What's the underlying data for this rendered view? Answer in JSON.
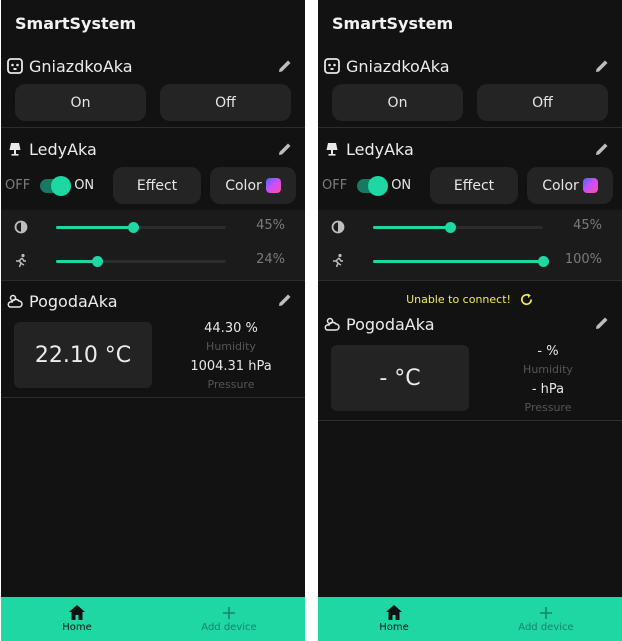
{
  "screens": [
    {
      "app_title": "SmartSystem",
      "socket": {
        "name": "GniazdkoAka",
        "on_label": "On",
        "off_label": "Off"
      },
      "leds": {
        "name": "LedyAka",
        "off_label": "OFF",
        "on_label": "ON",
        "toggle_on": true,
        "effect_label": "Effect",
        "color_label": "Color",
        "brightness": {
          "value": 45,
          "text": "45%"
        },
        "speed": {
          "value": 24,
          "text": "24%"
        }
      },
      "error": null,
      "weather": {
        "name": "PogodaAka",
        "temperature": "22.10 °C",
        "humidity": "44.30 %",
        "humidity_label": "Humidity",
        "pressure": "1004.31 hPa",
        "pressure_label": "Pressure"
      },
      "nav": {
        "home": "Home",
        "add": "Add device"
      }
    },
    {
      "app_title": "SmartSystem",
      "socket": {
        "name": "GniazdkoAka",
        "on_label": "On",
        "off_label": "Off"
      },
      "leds": {
        "name": "LedyAka",
        "off_label": "OFF",
        "on_label": "ON",
        "toggle_on": true,
        "effect_label": "Effect",
        "color_label": "Color",
        "brightness": {
          "value": 45,
          "text": "45%"
        },
        "speed": {
          "value": 100,
          "text": "100%"
        }
      },
      "error": {
        "text": "Unable to connect!"
      },
      "weather": {
        "name": "PogodaAka",
        "temperature": "- °C",
        "humidity": "- %",
        "humidity_label": "Humidity",
        "pressure": "- hPa",
        "pressure_label": "Pressure"
      },
      "nav": {
        "home": "Home",
        "add": "Add device"
      }
    }
  ],
  "colors": {
    "accent": "#1ed7a3",
    "background": "#121212",
    "surface": "#242424",
    "warning": "#f2ea5a"
  },
  "icons": {
    "socket": "power-socket-icon",
    "leds": "lamp-icon",
    "weather": "weather-partly-cloudy-icon",
    "edit": "pencil-icon",
    "brightness": "brightness-icon",
    "speed": "running-person-icon",
    "retry": "refresh-icon",
    "home": "home-icon",
    "add": "plus-icon"
  }
}
